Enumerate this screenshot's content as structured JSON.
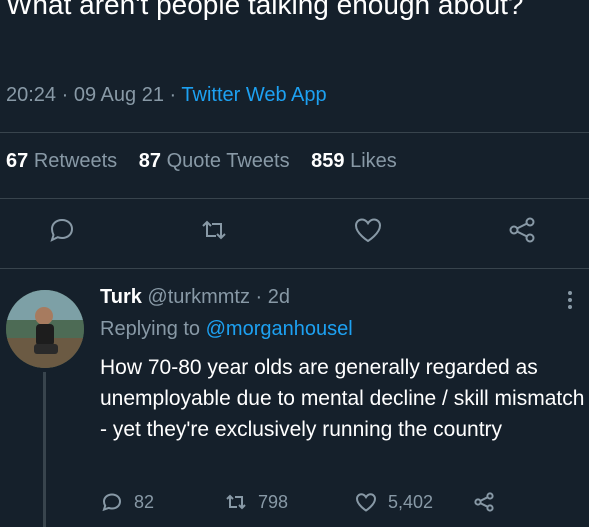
{
  "main_tweet": {
    "text": "What aren't people talking enough about?",
    "time": "20:24",
    "date": "09 Aug 21",
    "source": "Twitter Web App",
    "separator": "·"
  },
  "stats": {
    "retweets_count": "67",
    "retweets_label": "Retweets",
    "quote_count": "87",
    "quote_label": "Quote Tweets",
    "likes_count": "859",
    "likes_label": "Likes"
  },
  "actions": {
    "icons": [
      "reply-icon",
      "retweet-icon",
      "like-icon",
      "share-icon"
    ]
  },
  "reply": {
    "name": "Turk",
    "handle": "@turkmmtz",
    "separator": "·",
    "age": "2d",
    "replying_prefix": "Replying to",
    "replying_to": "@morganhousel",
    "text": "How 70-80 year olds are generally regarded as unemployable due to mental decline / skill mismatch - yet they're exclusively running the country",
    "reply_count": "82",
    "retweet_count": "798",
    "like_count": "5,402"
  },
  "colors": {
    "background": "#15202b",
    "text_primary": "#ffffff",
    "text_secondary": "#8899a6",
    "accent": "#1da1f2",
    "divider": "#38444d"
  }
}
